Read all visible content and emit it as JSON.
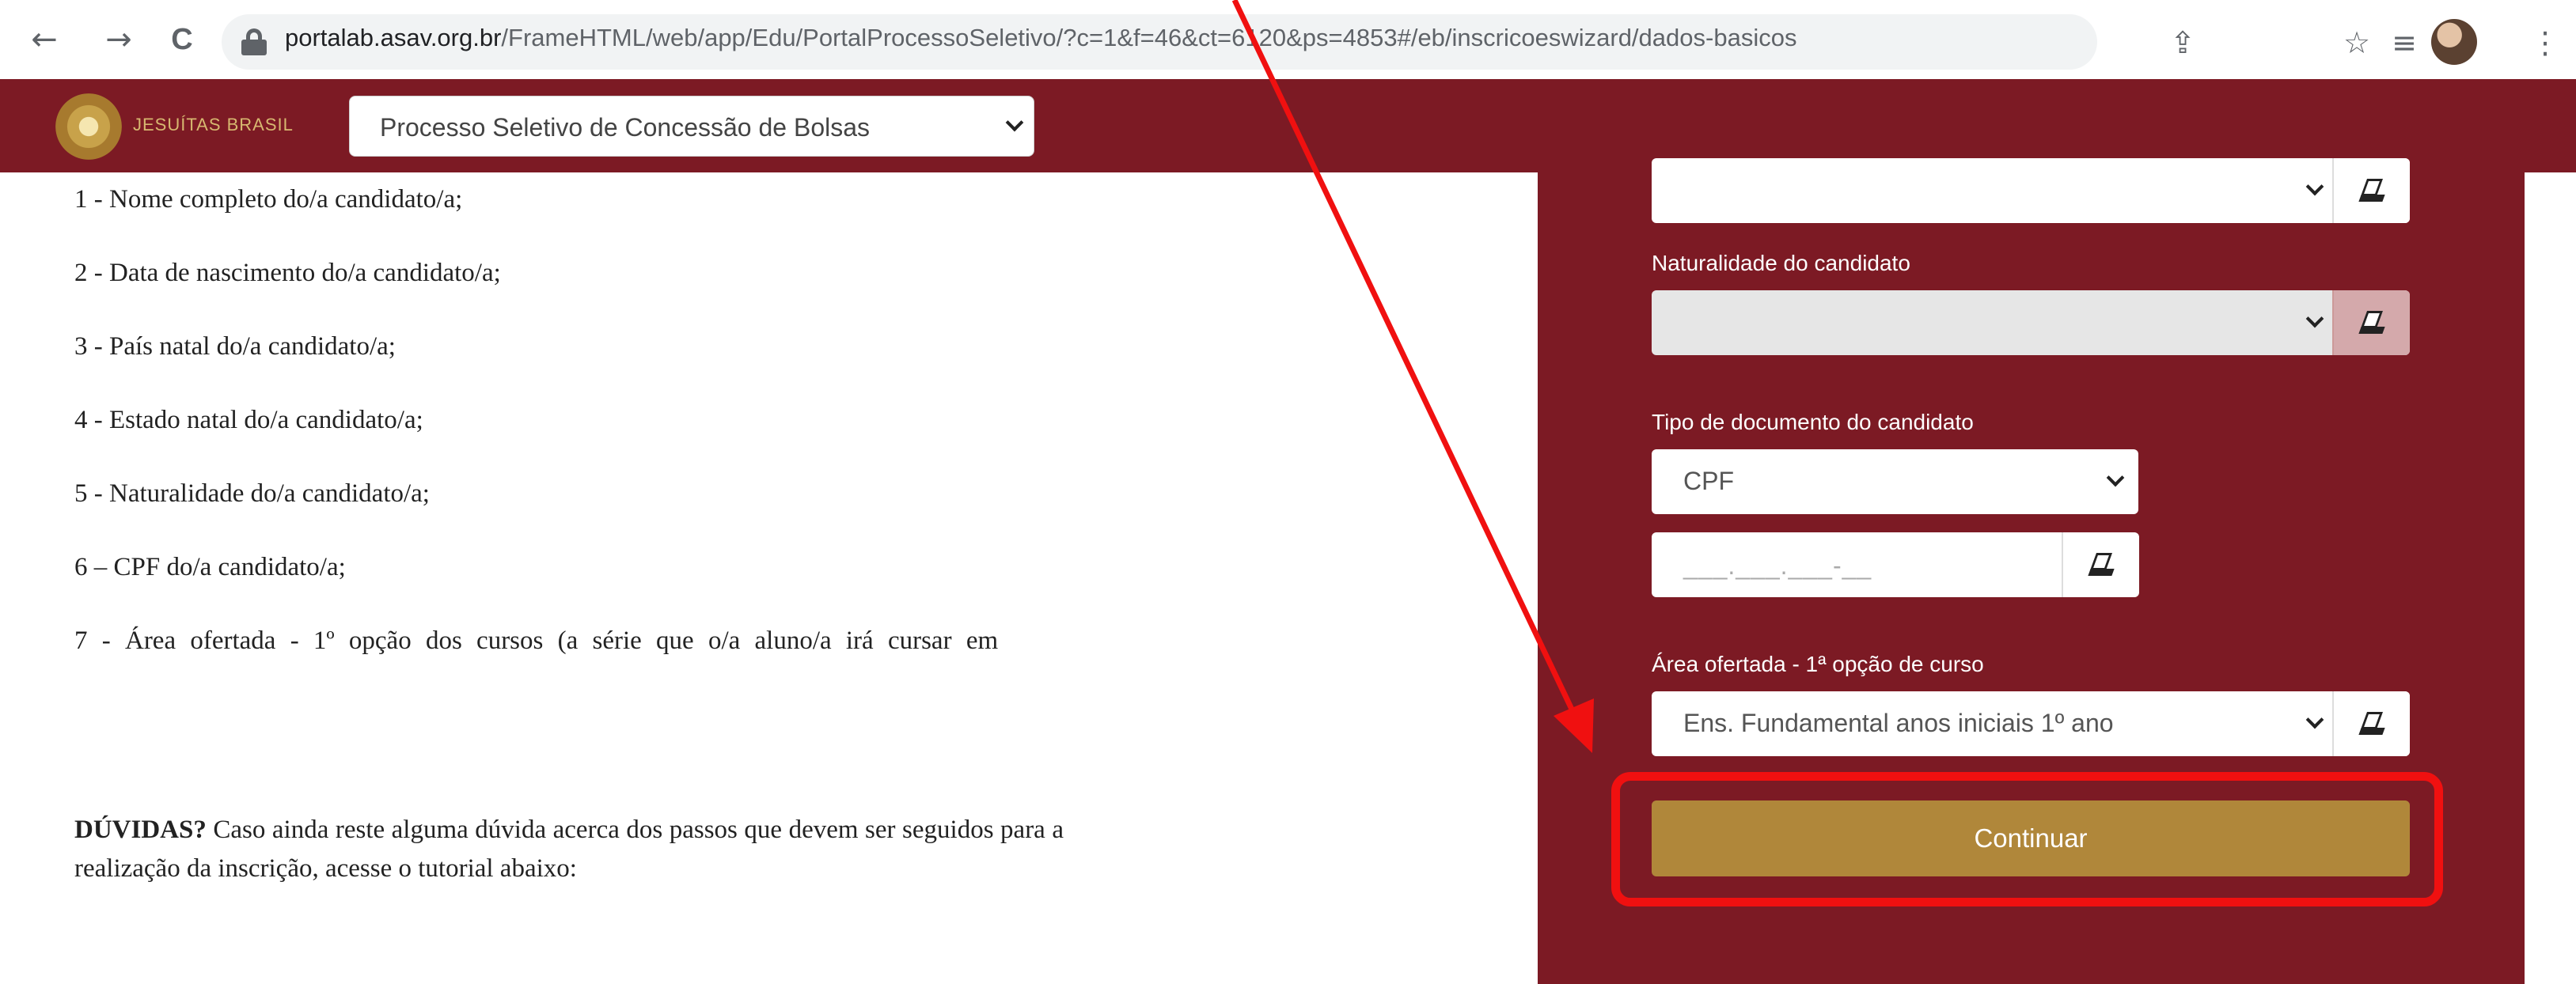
{
  "browser": {
    "url_host": "portalab.asav.org.br",
    "url_path": "/FrameHTML/web/app/Edu/PortalProcessoSeletivo/?c=1&f=46&ct=6120&ps=4853#/eb/inscricoeswizard/dados-basicos",
    "icons": [
      "back-arrow-icon",
      "forward-arrow-icon",
      "reload-icon",
      "lock-icon",
      "share-icon",
      "star-icon",
      "reading-list-icon",
      "profile-avatar",
      "more-menu-icon"
    ],
    "glyphs": {
      "back": "←",
      "forward": "→",
      "reload": "C",
      "share": "⇪",
      "star": "☆",
      "reading_list": "≡",
      "more": "⋮"
    }
  },
  "header": {
    "logo_text": "JESUÍTAS BRASIL",
    "process_select_value": "Processo Seletivo de Concessão de Bolsas",
    "colors": {
      "brand": "#7c1a24",
      "gold": "#b0873a"
    }
  },
  "instructions": {
    "items": [
      "1 - Nome completo do/a candidato/a;",
      "2 - Data de nascimento do/a candidato/a;",
      "3 - País natal do/a candidato/a;",
      "4 - Estado natal do/a candidato/a;",
      "5 - Naturalidade do/a candidato/a;",
      "6 – CPF do/a candidato/a;",
      "7 - Área ofertada - 1º opção dos cursos (a série que o/a aluno/a irá cursar em"
    ],
    "duvidas_bold": "DÚVIDAS?",
    "duvidas_text": " Caso ainda reste alguma dúvida acerca dos passos que devem ser seguidos para a realização da inscrição, acesse o tutorial abaixo:"
  },
  "form": {
    "top_select_value": "",
    "naturalidade_label": "Naturalidade do candidato",
    "naturalidade_value": "",
    "tipo_documento_label": "Tipo de documento do candidato",
    "tipo_documento_value": "CPF",
    "cpf_placeholder": "___.___.___-__",
    "area_label": "Área ofertada - 1ª opção de curso",
    "area_value": "Ens. Fundamental anos iniciais 1º ano",
    "continue_label": "Continuar"
  },
  "annotation": {
    "color": "#f01010"
  }
}
